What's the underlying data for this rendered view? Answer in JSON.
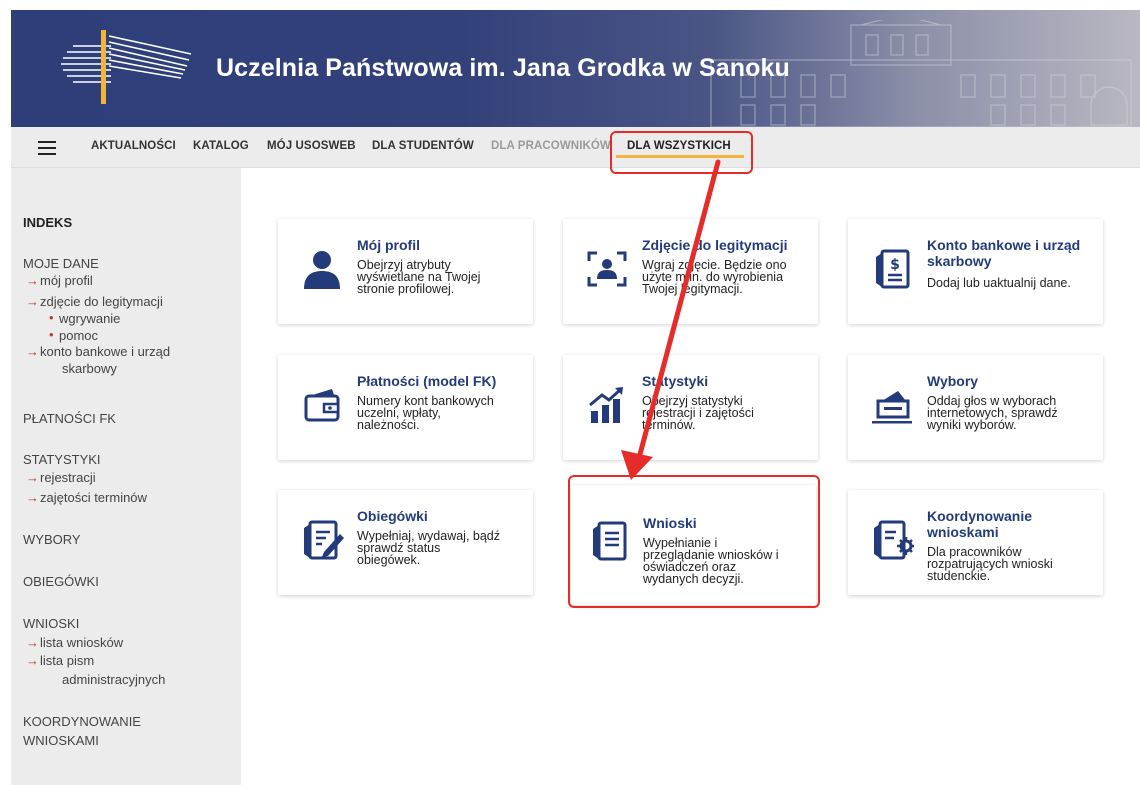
{
  "header": {
    "title": "Uczelnia Państwowa im. Jana Grodka w Sanoku"
  },
  "nav": {
    "items": [
      {
        "label": "AKTUALNOŚCI",
        "state": "normal"
      },
      {
        "label": "KATALOG",
        "state": "normal"
      },
      {
        "label": "MÓJ USOSWEB",
        "state": "normal"
      },
      {
        "label": "DLA STUDENTÓW",
        "state": "normal"
      },
      {
        "label": "DLA PRACOWNIKÓW",
        "state": "dim"
      },
      {
        "label": "DLA WSZYSTKICH",
        "state": "active"
      }
    ],
    "accent": "#f3b43a"
  },
  "sidebar": {
    "indeks": "INDEKS",
    "moje_dane": "MOJE DANE",
    "moj_profil": "mój profil",
    "zdjecie": "zdjęcie do legitymacji",
    "wgrywanie": "wgrywanie",
    "pomoc": "pomoc",
    "konto_1": "konto bankowe i urząd",
    "konto_2": "skarbowy",
    "platnosci": "PŁATNOŚCI FK",
    "statystyki": "STATYSTYKI",
    "rejestracji": "rejestracji",
    "zajetosci": "zajętości terminów",
    "wybory": "WYBORY",
    "obiegowki": "OBIEGÓWKI",
    "wnioski": "WNIOSKI",
    "lista_wnioskow": "lista wniosków",
    "lista_pism_1": "lista pism",
    "lista_pism_2": "administracyjnych",
    "koordynowanie_1": "KOORDYNOWANIE",
    "koordynowanie_2": "WNIOSKAMI"
  },
  "cards": {
    "profil": {
      "title": "Mój profil",
      "desc": [
        "Obejrzyj atrybuty",
        "wyświetlane na Twojej",
        "stronie profilowej."
      ],
      "icon": "user-icon"
    },
    "zdjecie": {
      "title": "Zdjęcie do legitymacji",
      "desc": [
        "Wgraj zdjęcie. Będzie ono",
        "użyte m.in. do wyrobienia",
        "Twojej legitymacji."
      ],
      "icon": "photo-frame-icon"
    },
    "konto": {
      "title": [
        "Konto bankowe i urząd",
        "skarbowy"
      ],
      "desc": [
        "Dodaj lub uaktualnij dane."
      ],
      "icon": "bank-document-icon"
    },
    "platnosci": {
      "title": "Płatności (model FK)",
      "desc": [
        "Numery kont bankowych",
        "uczelni, wpłaty,",
        "należności."
      ],
      "icon": "wallet-icon"
    },
    "statystyki": {
      "title": "Statystyki",
      "desc": [
        "Obejrzyj statystyki",
        "rejestracji i zajętości",
        "terminów."
      ],
      "icon": "chart-icon"
    },
    "wybory": {
      "title": "Wybory",
      "desc": [
        "Oddaj głos w wyborach",
        "internetowych, sprawdź",
        "wyniki wyborów."
      ],
      "icon": "ballot-box-icon"
    },
    "obiegowki": {
      "title": "Obiegówki",
      "desc": [
        "Wypełniaj, wydawaj, bądź",
        "sprawdź status",
        "obiegówek."
      ],
      "icon": "document-edit-icon"
    },
    "wnioski": {
      "title": "Wnioski",
      "desc": [
        "Wypełnianie i",
        "przeglądanie wniosków i",
        "oświadczeń oraz",
        "wydanych decyzji."
      ],
      "icon": "document-list-icon"
    },
    "koordynowanie": {
      "title": [
        "Koordynowanie",
        "wnioskami"
      ],
      "desc": [
        "Dla pracowników",
        "rozpatrujących wnioski",
        "studenckie."
      ],
      "icon": "document-gear-icon"
    }
  },
  "colors": {
    "header_bg": "#2d3e79",
    "card_title": "#233b7a",
    "annotation": "#e62b2b",
    "sidebar_arrow": "#c0392b"
  }
}
